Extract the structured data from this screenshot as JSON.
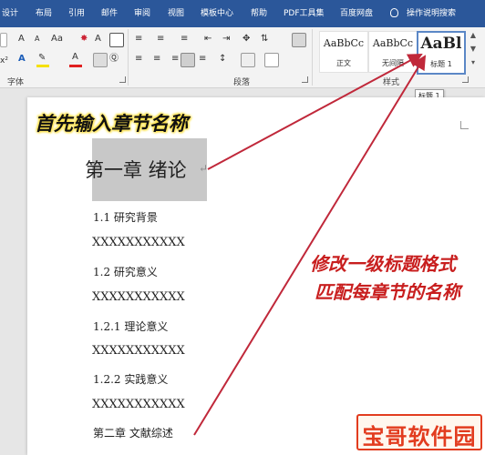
{
  "tabs": [
    "设计",
    "布局",
    "引用",
    "邮件",
    "审阅",
    "视图",
    "模板中心",
    "帮助",
    "PDF工具集",
    "百度网盘",
    "操作说明搜索"
  ],
  "ribbon": {
    "font_group_label": "字体",
    "paragraph_group_label": "段落",
    "styles_group_label": "样式",
    "font_buttons": [
      "A",
      "A",
      "Aa",
      "A",
      "x²",
      "A"
    ],
    "styles": [
      {
        "sample": "AaBbCc",
        "name": "正文"
      },
      {
        "sample": "AaBbCc",
        "name": "无间隔"
      },
      {
        "sample": "AaBl",
        "name": "标题 1"
      }
    ],
    "tooltip": "标题 1"
  },
  "document": {
    "heading": "第一章 绪论",
    "lines": [
      "1.1 研究背景",
      "XXXXXXXXXXX",
      "1.2 研究意义",
      "XXXXXXXXXXX",
      "1.2.1 理论意义",
      "XXXXXXXXXXX",
      "1.2.2 实践意义",
      "XXXXXXXXXXX",
      "第二章 文献综述"
    ]
  },
  "annotations": {
    "top": "首先输入章节名称",
    "right_1": "修改一级标题格式",
    "right_2": "匹配每章节的名称"
  },
  "watermark": "宝哥软件园",
  "colors": {
    "tab_bar": "#2b579a",
    "annotation_red": "#c81e1e",
    "arrow": "#c0283a",
    "highlight": "#c8c8c8",
    "font_color_bar": "#e02020",
    "highlight_bar": "#f5e000"
  }
}
